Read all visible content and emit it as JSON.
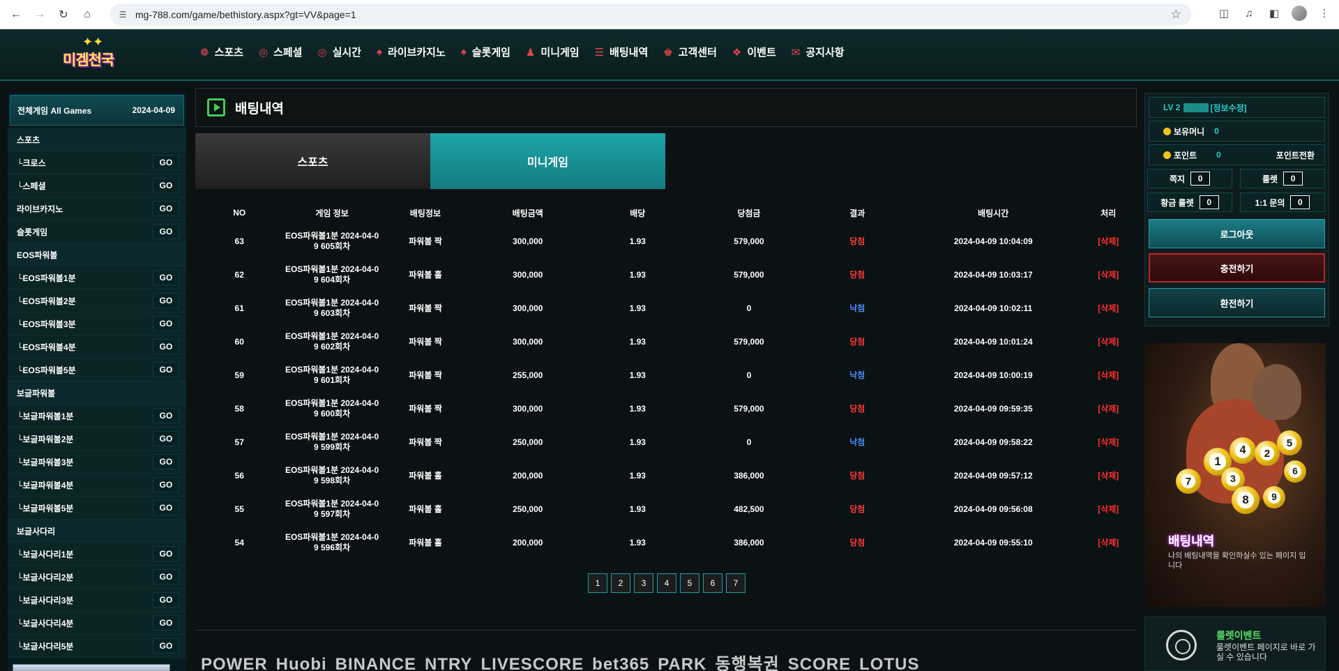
{
  "browser": {
    "url": "mg-788.com/game/bethistory.aspx?gt=VV&page=1"
  },
  "logo": {
    "text": "미겜천국"
  },
  "nav": {
    "items": [
      {
        "label": "스포츠",
        "icon": "sports-icon"
      },
      {
        "label": "스페셜",
        "icon": "basketball-icon"
      },
      {
        "label": "실시간",
        "icon": "basketball-icon"
      },
      {
        "label": "라이브카지노",
        "icon": "spade-icon"
      },
      {
        "label": "슬롯게임",
        "icon": "spade-icon"
      },
      {
        "label": "미니게임",
        "icon": "person-icon"
      },
      {
        "label": "배팅내역",
        "icon": "list-icon"
      },
      {
        "label": "고객센터",
        "icon": "support-icon"
      },
      {
        "label": "이벤트",
        "icon": "gift-icon"
      },
      {
        "label": "공지사항",
        "icon": "notice-icon"
      }
    ]
  },
  "sidebar": {
    "header_title": "전체게임 All Games",
    "header_date": "2024-04-09",
    "go_label": "GO",
    "items": [
      {
        "label": "스포츠",
        "type": "category"
      },
      {
        "label": "└크로스",
        "type": "go"
      },
      {
        "label": "└스페셜",
        "type": "go"
      },
      {
        "label": "라이브카지노",
        "type": "go"
      },
      {
        "label": "슬롯게임",
        "type": "go"
      },
      {
        "label": "EOS파워볼",
        "type": "category"
      },
      {
        "label": "└EOS파워볼1분",
        "type": "go"
      },
      {
        "label": "└EOS파워볼2분",
        "type": "go"
      },
      {
        "label": "└EOS파워볼3분",
        "type": "go"
      },
      {
        "label": "└EOS파워볼4분",
        "type": "go"
      },
      {
        "label": "└EOS파워볼5분",
        "type": "go"
      },
      {
        "label": "보글파워볼",
        "type": "category"
      },
      {
        "label": "└보글파워볼1분",
        "type": "go"
      },
      {
        "label": "└보글파워볼2분",
        "type": "go"
      },
      {
        "label": "└보글파워볼3분",
        "type": "go"
      },
      {
        "label": "└보글파워볼4분",
        "type": "go"
      },
      {
        "label": "└보글파워볼5분",
        "type": "go"
      },
      {
        "label": "보글사다리",
        "type": "category"
      },
      {
        "label": "└보글사다리1분",
        "type": "go"
      },
      {
        "label": "└보글사다리2분",
        "type": "go"
      },
      {
        "label": "└보글사다리3분",
        "type": "go"
      },
      {
        "label": "└보글사다리4분",
        "type": "go"
      },
      {
        "label": "└보글사다리5분",
        "type": "go"
      }
    ]
  },
  "main": {
    "title": "배팅내역",
    "tabs": [
      {
        "label": "스포츠",
        "active": false
      },
      {
        "label": "미니게임",
        "active": true
      }
    ],
    "columns": [
      "NO",
      "게임 정보",
      "배팅정보",
      "배팅금액",
      "배당",
      "당첨금",
      "결과",
      "배팅시간",
      "처리"
    ],
    "rows": [
      {
        "no": "63",
        "info": "EOS파워볼1분 2024-04-0 9 605회차",
        "bet": "파워볼 짝",
        "amount": "300,000",
        "odds": "1.93",
        "payout": "579,000",
        "result": "당첨",
        "time": "2024-04-09 10:04:09",
        "action": "[삭제]"
      },
      {
        "no": "62",
        "info": "EOS파워볼1분 2024-04-0 9 604회차",
        "bet": "파워볼 홀",
        "amount": "300,000",
        "odds": "1.93",
        "payout": "579,000",
        "result": "당첨",
        "time": "2024-04-09 10:03:17",
        "action": "[삭제]"
      },
      {
        "no": "61",
        "info": "EOS파워볼1분 2024-04-0 9 603회차",
        "bet": "파워볼 짝",
        "amount": "300,000",
        "odds": "1.93",
        "payout": "0",
        "result": "낙첨",
        "time": "2024-04-09 10:02:11",
        "action": "[삭제]"
      },
      {
        "no": "60",
        "info": "EOS파워볼1분 2024-04-0 9 602회차",
        "bet": "파워볼 짝",
        "amount": "300,000",
        "odds": "1.93",
        "payout": "579,000",
        "result": "당첨",
        "time": "2024-04-09 10:01:24",
        "action": "[삭제]"
      },
      {
        "no": "59",
        "info": "EOS파워볼1분 2024-04-0 9 601회차",
        "bet": "파워볼 짝",
        "amount": "255,000",
        "odds": "1.93",
        "payout": "0",
        "result": "낙첨",
        "time": "2024-04-09 10:00:19",
        "action": "[삭제]"
      },
      {
        "no": "58",
        "info": "EOS파워볼1분 2024-04-0 9 600회차",
        "bet": "파워볼 짝",
        "amount": "300,000",
        "odds": "1.93",
        "payout": "579,000",
        "result": "당첨",
        "time": "2024-04-09 09:59:35",
        "action": "[삭제]"
      },
      {
        "no": "57",
        "info": "EOS파워볼1분 2024-04-0 9 599회차",
        "bet": "파워볼 짝",
        "amount": "250,000",
        "odds": "1.93",
        "payout": "0",
        "result": "낙첨",
        "time": "2024-04-09 09:58:22",
        "action": "[삭제]"
      },
      {
        "no": "56",
        "info": "EOS파워볼1분 2024-04-0 9 598회차",
        "bet": "파워볼 홀",
        "amount": "200,000",
        "odds": "1.93",
        "payout": "386,000",
        "result": "당첨",
        "time": "2024-04-09 09:57:12",
        "action": "[삭제]"
      },
      {
        "no": "55",
        "info": "EOS파워볼1분 2024-04-0 9 597회차",
        "bet": "파워볼 홀",
        "amount": "250,000",
        "odds": "1.93",
        "payout": "482,500",
        "result": "당첨",
        "time": "2024-04-09 09:56:08",
        "action": "[삭제]"
      },
      {
        "no": "54",
        "info": "EOS파워볼1분 2024-04-0 9 596회차",
        "bet": "파워볼 홀",
        "amount": "200,000",
        "odds": "1.93",
        "payout": "386,000",
        "result": "당첨",
        "time": "2024-04-09 09:55:10",
        "action": "[삭제]"
      }
    ],
    "pages": [
      "1",
      "2",
      "3",
      "4",
      "5",
      "6",
      "7"
    ],
    "partners": [
      "POWER",
      "Huobi",
      "BINANCE",
      "NTRY",
      "LIVESCORE",
      "bet365",
      "PARK",
      "동행복권",
      "SCORE",
      "LOTUS"
    ]
  },
  "user_panel": {
    "level": "LV 2",
    "edit_label": "[정보수정]",
    "money_label": "보유머니",
    "money_value": "0",
    "point_label": "포인트",
    "point_value": "0",
    "point_convert": "포인트전환",
    "note_label": "쪽지",
    "note_count": "0",
    "roulette_label": "룰렛",
    "roulette_count": "0",
    "gold_roulette_label": "황금 룰렛",
    "gold_roulette_count": "0",
    "inquiry_label": "1:1 문의",
    "inquiry_count": "0",
    "logout_label": "로그아웃",
    "charge_label": "충전하기",
    "exchange_label": "환전하기"
  },
  "banner": {
    "title": "배팅내역",
    "subtitle": "나의 배팅내역을 확인하실수 있는 페이지 입니다",
    "balls": [
      "1",
      "4",
      "2",
      "5",
      "7",
      "3",
      "6",
      "8",
      "9"
    ]
  },
  "event": {
    "title": "룰렛이벤트",
    "subtitle": "룰렛이벤트 페이지로 바로 가실 수 있습니다"
  },
  "colors": {
    "accent_teal": "#1ca5a8",
    "win_red": "#ff3a3a",
    "lose_blue": "#4b8cff",
    "title_green": "#47c85b"
  }
}
